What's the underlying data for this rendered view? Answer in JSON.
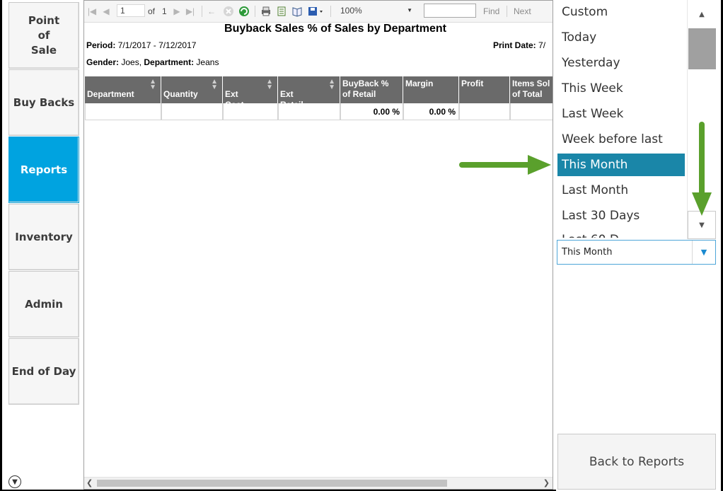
{
  "nav": {
    "items": [
      {
        "label": "Point\nof\nSale",
        "active": false
      },
      {
        "label": "Buy Backs",
        "active": false
      },
      {
        "label": "Reports",
        "active": true
      },
      {
        "label": "Inventory",
        "active": false
      },
      {
        "label": "Admin",
        "active": false
      },
      {
        "label": "End of Day",
        "active": false
      }
    ],
    "active_color": "#00a3e0"
  },
  "toolbar": {
    "page_current": "1",
    "page_of_label": "of",
    "page_total": "1",
    "zoom": "100%",
    "find_value": "",
    "find_label": "Find",
    "next_label": "Next"
  },
  "report": {
    "title": "Buyback Sales % of Sales by Department",
    "period_label": "Period:",
    "period_value": "7/1/2017 - 7/12/2017",
    "print_date_label": "Print Date:",
    "print_date_value": "7/",
    "gender_label": "Gender:",
    "gender_value": "Joes,",
    "department_label": "Department:",
    "department_value": "Jeans",
    "columns": [
      "Department",
      "Quantity",
      "Ext\nCost",
      "Ext\nRetail",
      "BuyBack %\nof Retail",
      "Margin",
      "Profit",
      "Items Sol\nof Total"
    ],
    "row": [
      "",
      "",
      "",
      "",
      "0.00 %",
      "0.00 %",
      "",
      ""
    ]
  },
  "date_range": {
    "options": [
      "Custom",
      "Today",
      "Yesterday",
      "This Week",
      "Last Week",
      "Week before last",
      "This Month",
      "Last Month",
      "Last 30 Days",
      "Last 60 D"
    ],
    "selected": "This Month",
    "selected_index": 6,
    "highlight_color": "#1a86a8"
  },
  "back_button_label": "Back to Reports",
  "annotation_color": "#5aa02c"
}
